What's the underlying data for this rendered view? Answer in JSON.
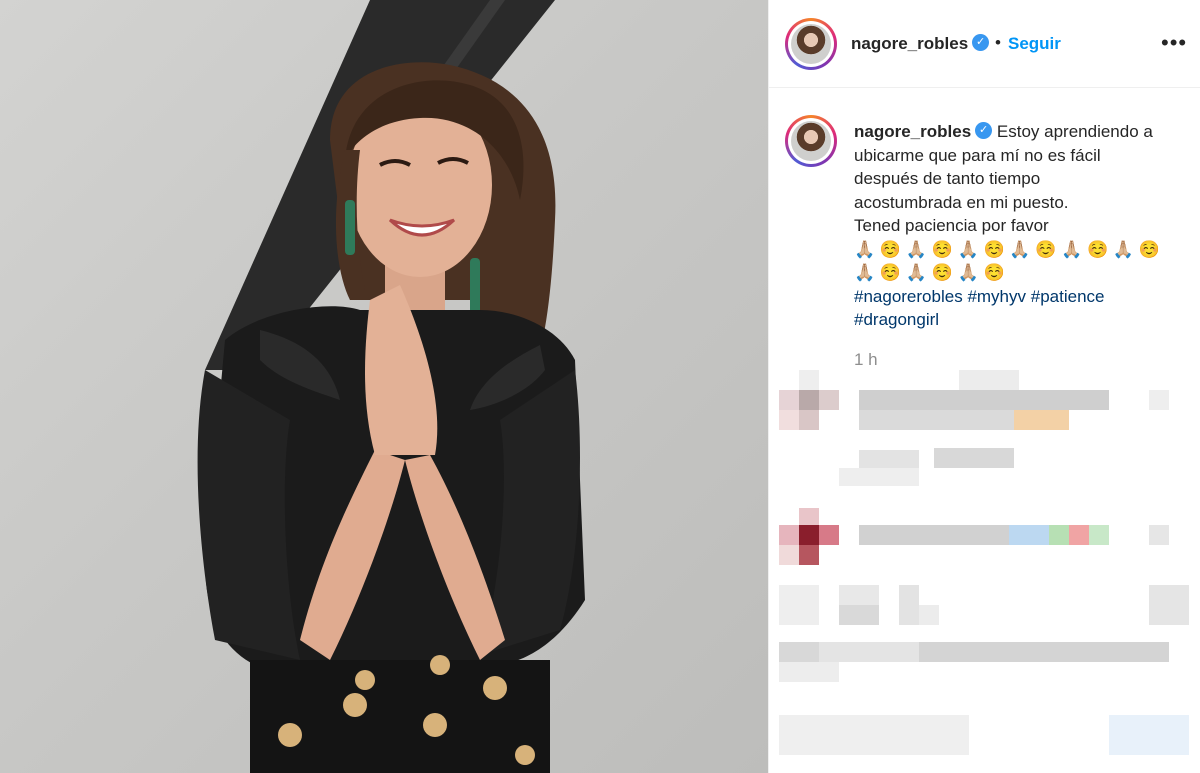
{
  "post": {
    "author": "nagore_robles",
    "verified_mark": "✓",
    "separator": "•",
    "follow_label": "Seguir",
    "more_label": "•••",
    "caption_lines": [
      "Estoy aprendiendo a",
      "ubicarme que para mí no es fácil",
      "después de tanto tiempo",
      "acostumbrada en mi puesto.",
      "Tened paciencia por favor",
      "🙏🏼 ☺️ 🙏🏼 ☺️ 🙏🏼 ☺️ 🙏🏼 ☺️ 🙏🏼 ☺️ 🙏🏼 ☺️",
      "🙏🏼 ☺️ 🙏🏼 ☺️ 🙏🏼 ☺️"
    ],
    "hashtags_line1": [
      "#nagorerobles",
      "#myhyv",
      "#patience"
    ],
    "hashtags_line2": [
      "#dragongirl"
    ],
    "time_ago": "1 h"
  },
  "colors": {
    "accent": "#0095f6",
    "verified": "#3897f0",
    "hashtag": "#00376b",
    "muted": "#8e8e8e"
  },
  "icons": {
    "verified": "verified-badge-icon",
    "more": "more-options-icon"
  }
}
